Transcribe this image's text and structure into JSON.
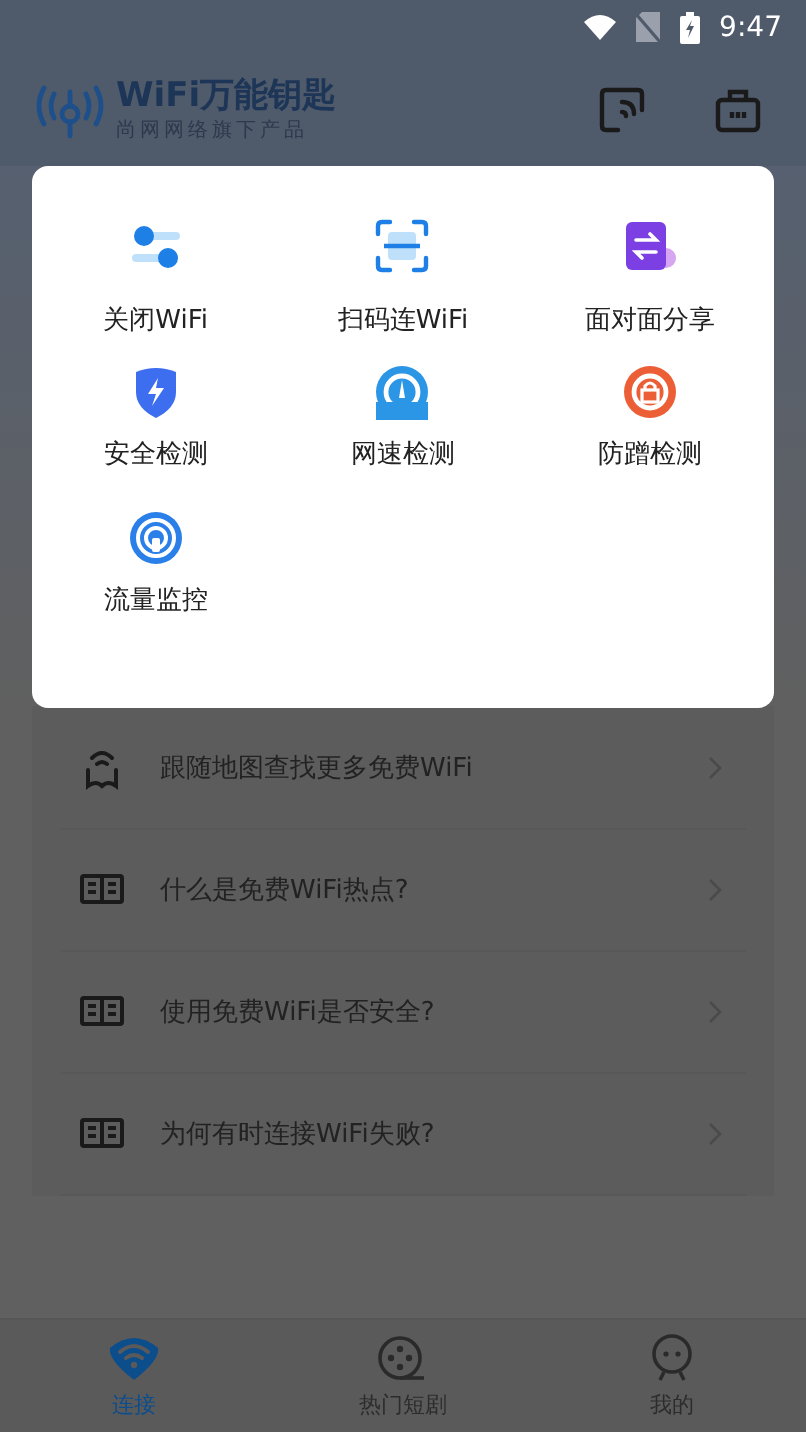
{
  "status_bar": {
    "time": "9:47"
  },
  "header": {
    "title": "WiFi万能钥匙",
    "subtitle": "尚网网络旗下产品"
  },
  "popup": {
    "items": [
      {
        "kind": "toggle",
        "label": "关闭WiFi"
      },
      {
        "kind": "scan",
        "label": "扫码连WiFi"
      },
      {
        "kind": "share",
        "label": "面对面分享"
      },
      {
        "kind": "shield",
        "label": "安全检测"
      },
      {
        "kind": "speed",
        "label": "网速检测"
      },
      {
        "kind": "lock",
        "label": "防蹭检测"
      },
      {
        "kind": "signal",
        "label": "流量监控"
      }
    ]
  },
  "list": [
    {
      "kind": "map",
      "label": "跟随地图查找更多免费WiFi"
    },
    {
      "kind": "article",
      "label": "什么是免费WiFi热点?"
    },
    {
      "kind": "article",
      "label": "使用免费WiFi是否安全?"
    },
    {
      "kind": "article",
      "label": "为何有时连接WiFi失败?"
    }
  ],
  "tabs": [
    {
      "kind": "wifi",
      "label": "连接",
      "selected": true
    },
    {
      "kind": "film",
      "label": "热门短剧",
      "selected": false
    },
    {
      "kind": "face",
      "label": "我的",
      "selected": false
    }
  ]
}
